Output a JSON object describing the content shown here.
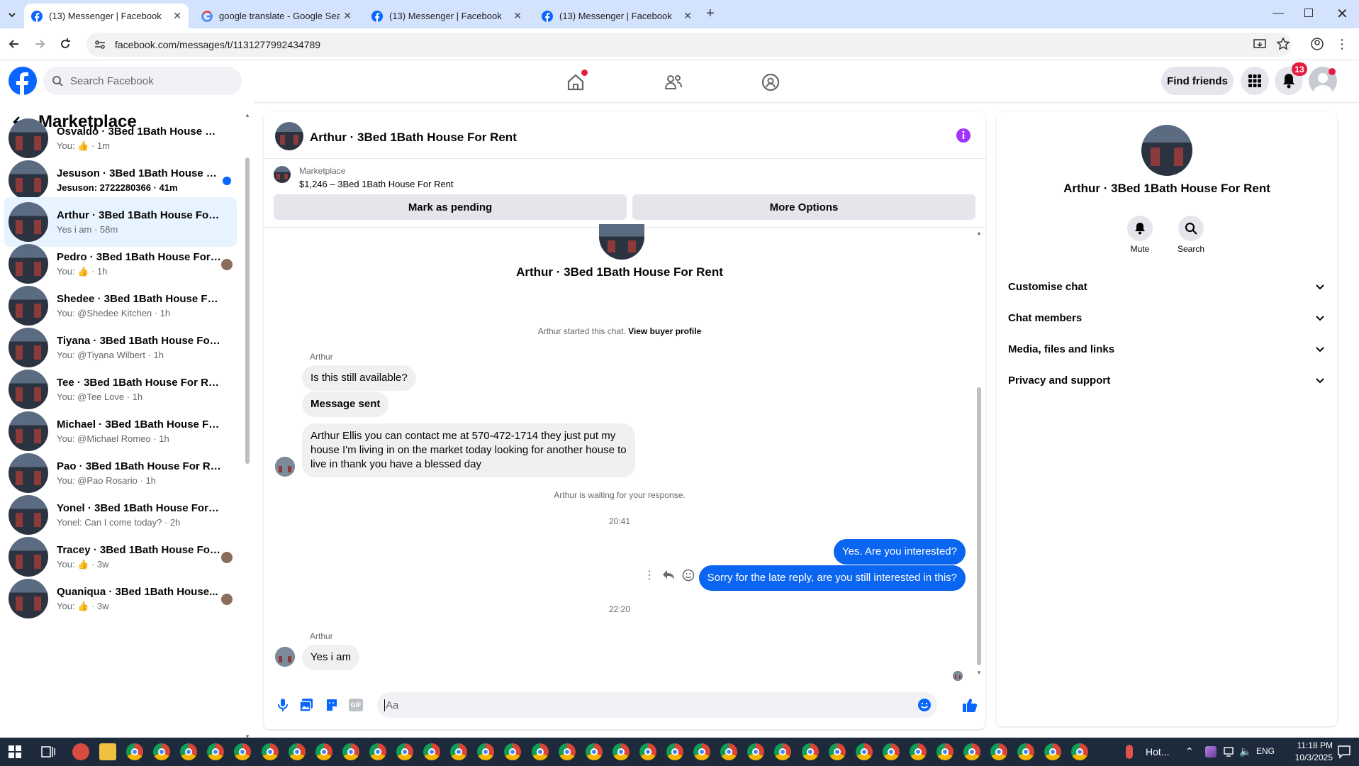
{
  "browser": {
    "tabs": [
      {
        "title": "(13) Messenger | Facebook",
        "active": true,
        "icon": "facebook-icon"
      },
      {
        "title": "google translate - Google Search",
        "active": false,
        "icon": "google-icon"
      },
      {
        "title": "(13) Messenger | Facebook",
        "active": false,
        "icon": "facebook-icon"
      },
      {
        "title": "(13) Messenger | Facebook",
        "active": false,
        "icon": "facebook-icon"
      }
    ],
    "url": "facebook.com/messages/t/1131277992434789"
  },
  "header": {
    "search_placeholder": "Search Facebook",
    "find_friends": "Find friends",
    "notifications_badge": "13"
  },
  "sidebar": {
    "title": "Marketplace",
    "conversations": [
      {
        "name": "Osvaldo · 3Bed 1Bath House For ...",
        "preview": "You: 👍 · 1m",
        "unread": false,
        "selected": false
      },
      {
        "name": "Jesuson · 3Bed 1Bath House Fo...",
        "preview": "Jesuson: 2722280366 · 41m",
        "unread": true,
        "selected": false
      },
      {
        "name": "Arthur · 3Bed 1Bath House For R...",
        "preview": "Yes i am · 58m",
        "unread": false,
        "selected": true
      },
      {
        "name": "Pedro · 3Bed 1Bath House For ...",
        "preview": "You: 👍 · 1h",
        "unread": false,
        "selected": false
      },
      {
        "name": "Shedee · 3Bed 1Bath House For ...",
        "preview": "You: @Shedee Kitchen · 1h",
        "unread": false,
        "selected": false
      },
      {
        "name": "Tiyana · 3Bed 1Bath House For R...",
        "preview": "You: @Tiyana Wilbert · 1h",
        "unread": false,
        "selected": false
      },
      {
        "name": "Tee · 3Bed 1Bath House For Rent",
        "preview": "You: @Tee Love · 1h",
        "unread": false,
        "selected": false
      },
      {
        "name": "Michael · 3Bed 1Bath House For ...",
        "preview": "You: @Michael Romeo · 1h",
        "unread": false,
        "selected": false
      },
      {
        "name": "Pao · 3Bed 1Bath House For Rent",
        "preview": "You: @Pao Rosario · 1h",
        "unread": false,
        "selected": false
      },
      {
        "name": "Yonel · 3Bed 1Bath House For Re...",
        "preview": "Yonel: Can I come today? · 2h",
        "unread": false,
        "selected": false
      },
      {
        "name": "Tracey · 3Bed 1Bath House For...",
        "preview": "You: 👍 · 3w",
        "unread": false,
        "selected": false
      },
      {
        "name": "Quaniqua · 3Bed 1Bath House...",
        "preview": "You: 👍 · 3w",
        "unread": false,
        "selected": false
      }
    ]
  },
  "chat": {
    "title": "Arthur · 3Bed 1Bath House For Rent",
    "listing_source": "Marketplace",
    "listing": "$1,246 – 3Bed 1Bath House For Rent",
    "mark_pending": "Mark as pending",
    "more_options": "More Options",
    "intro_name": "Arthur · 3Bed 1Bath House For Rent",
    "started_text": "Arthur started this chat.",
    "view_profile": "View buyer profile",
    "sender_label_1": "Arthur",
    "msg1": "Is this still available?",
    "msg2": "Message sent",
    "msg3": "Arthur Ellis you can contact me at 570-472-1714 they just put my house I'm living in on the market today looking for another house to live in thank you have a blessed day",
    "waiting": "Arthur is waiting for your response.",
    "time1": "20:41",
    "out1": "Yes. Are you interested?",
    "out2": "Sorry for the late reply, are you still interested in this?",
    "time2": "22:20",
    "sender_label_2": "Arthur",
    "msg4": "Yes i am",
    "composer_placeholder": "Aa"
  },
  "details": {
    "name": "Arthur · 3Bed 1Bath House For Rent",
    "mute": "Mute",
    "search": "Search",
    "sections": [
      "Customise chat",
      "Chat members",
      "Media, files and links",
      "Privacy and support"
    ]
  },
  "taskbar": {
    "weather": "Hot...",
    "lang": "ENG",
    "time": "11:18 PM",
    "date": "10/3/2025"
  },
  "colors": {
    "fb_blue": "#0866ff",
    "outgoing_bubble": "#0a65f0",
    "info_purple": "#a033ff"
  }
}
